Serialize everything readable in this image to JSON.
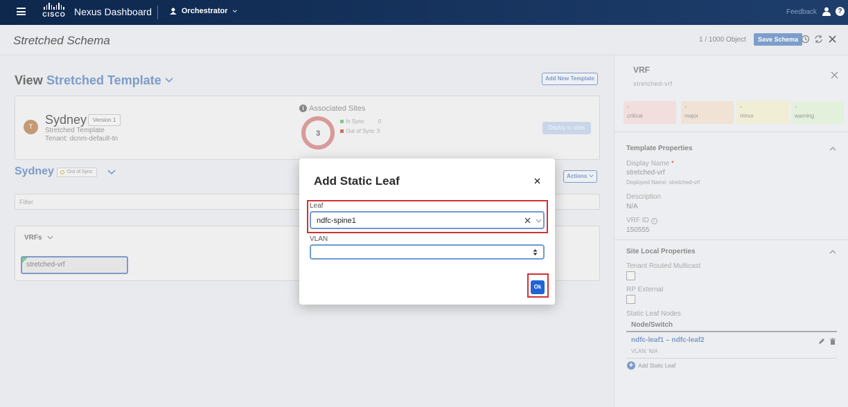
{
  "topbar": {
    "logo_text": "CISCO",
    "product": "Nexus Dashboard",
    "app": "Orchestrator",
    "feedback": "Feedback",
    "help": "?"
  },
  "subheader": {
    "title": "Stretched Schema",
    "object_count": "1 / 1000 Object",
    "save_label": "Save Schema"
  },
  "main": {
    "view_label": "View",
    "template_name": "Stretched Template",
    "add_template": "Add New Template",
    "site": {
      "avatar": "T",
      "name": "Sydney",
      "version": "Version 1",
      "template": "Stretched Template",
      "tenant": "Tenant: dcnm-default-tn"
    },
    "associated": {
      "icon": "i",
      "title": "Associated Sites",
      "count": "3",
      "in_sync_label": "In Sync",
      "in_sync_value": "0",
      "out_sync_label": "Out of Sync",
      "out_sync_value": "3",
      "in_color": "#7fc98d",
      "out_color": "#d46a6a"
    },
    "deploy": "Deploy to sites",
    "sydney_title": "Sydney",
    "sync_badge": "Out of Sync",
    "actions": "Actions",
    "filter_placeholder": "Filter",
    "vrfs_label": "VRFs",
    "vrf_chip": "stretched-vrf"
  },
  "panel": {
    "title": "VRF",
    "subtitle": "stretched-vrf",
    "severities": [
      {
        "dash": "-",
        "label": "critical",
        "color": "#f3dede"
      },
      {
        "dash": "-",
        "label": "major",
        "color": "#f0e3d6"
      },
      {
        "dash": "-",
        "label": "minor",
        "color": "#f1eed6"
      },
      {
        "dash": "-",
        "label": "warning",
        "color": "#e3f0dc"
      }
    ],
    "template_props": "Template Properties",
    "display_name_label": "Display Name",
    "display_name_star": "*",
    "display_name_value": "stretched-vrf",
    "deployed_name": "Deployed Name: stretched-vrf",
    "description_label": "Description",
    "description_value": "N/A",
    "vrf_id_label": "VRF ID",
    "vrf_id_icon": "i",
    "vrf_id_value": "150555",
    "site_local": "Site Local Properties",
    "trm_label": "Tenant Routed Multicast",
    "rp_label": "RP External",
    "static_leaf_label": "Static Leaf Nodes",
    "col_header": "Node/Switch",
    "leaf_row": "ndfc-leaf1 – ndfc-leaf2",
    "leaf_vlan": "VLAN: N/A",
    "add_leaf_icon": "+",
    "add_leaf": "Add Static Leaf"
  },
  "modal": {
    "title": "Add Static Leaf",
    "close": "×",
    "leaf_label": "Leaf",
    "leaf_value": "ndfc-spine1",
    "vlan_label": "VLAN",
    "vlan_value": "",
    "ok": "Ok"
  }
}
